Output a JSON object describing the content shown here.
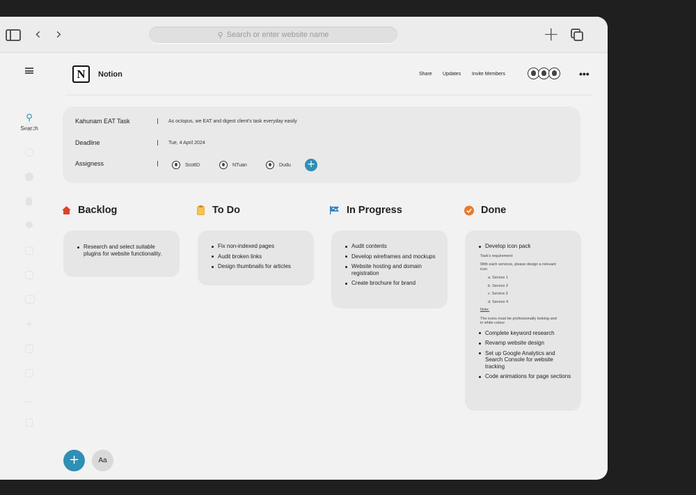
{
  "browser": {
    "address_placeholder": "Search or enter website name",
    "back_glyph": "‹",
    "forward_glyph": "›",
    "new_tab_glyph": "+"
  },
  "rail": {
    "search_label": "Search",
    "icons": [
      "menu-icon",
      "search-icon",
      "clock-icon",
      "settings-icon",
      "plus-circle-icon",
      "bell-icon",
      "user-icon",
      "calendar-icon",
      "gallery-icon",
      "board-icon",
      "plus-icon",
      "image-icon",
      "layout-icon",
      "download-icon",
      "trash-icon"
    ]
  },
  "header": {
    "logo_letter": "N",
    "title": "Notion",
    "share": "Share",
    "updates": "Updates",
    "invite": "Invite Members",
    "more": "•••"
  },
  "properties": [
    {
      "label": "Kahunam EAT Task",
      "value": "As octopus, we EAT and digest client's task everyday easily"
    },
    {
      "label": "Deadline",
      "value": "Tue, 4 April 2024"
    },
    {
      "label": "Assigness",
      "assignees": [
        "ScottD",
        "NTuan",
        "Dudu"
      ]
    }
  ],
  "columns": [
    {
      "title": "Backlog",
      "icon": "house-icon",
      "items": [
        "Research and select suitable plugins for website functionality."
      ]
    },
    {
      "title": "To Do",
      "icon": "clipboard-icon",
      "items": [
        "Fix non-indexed pages",
        "Audit broken links",
        "Design thumbnails for articles"
      ]
    },
    {
      "title": "In Progress",
      "icon": "flag-icon",
      "items": [
        "Audit contents",
        "Develop wireframes and mockups",
        "Website hosting and domain registration",
        "Create brochure for brand"
      ]
    },
    {
      "title": "Done",
      "icon": "check-circle-icon",
      "items": [
        "Develop icon pack",
        "Complete keyword research",
        "Revamp website design",
        "Set up Google Analytics and Search Console for website tracking",
        "Code animations for page sections"
      ],
      "detail": {
        "req_title": "Task's requirement:",
        "req_text": "With each services, please design a relevant icon",
        "services": [
          "a. Service 1",
          "b. Service 2",
          "c. Service 3",
          "d. Service 4"
        ],
        "note_title": "Note:",
        "note_text": "The icons must be professionally looking and in white colour"
      }
    }
  ],
  "fab": {
    "add": "+",
    "font": "Aa"
  },
  "colors": {
    "accent": "#2f8fb5",
    "backlog": "#d9452b",
    "todo": "#e8a93a",
    "progress": "#2f7fc1",
    "done": "#e87a2a"
  }
}
